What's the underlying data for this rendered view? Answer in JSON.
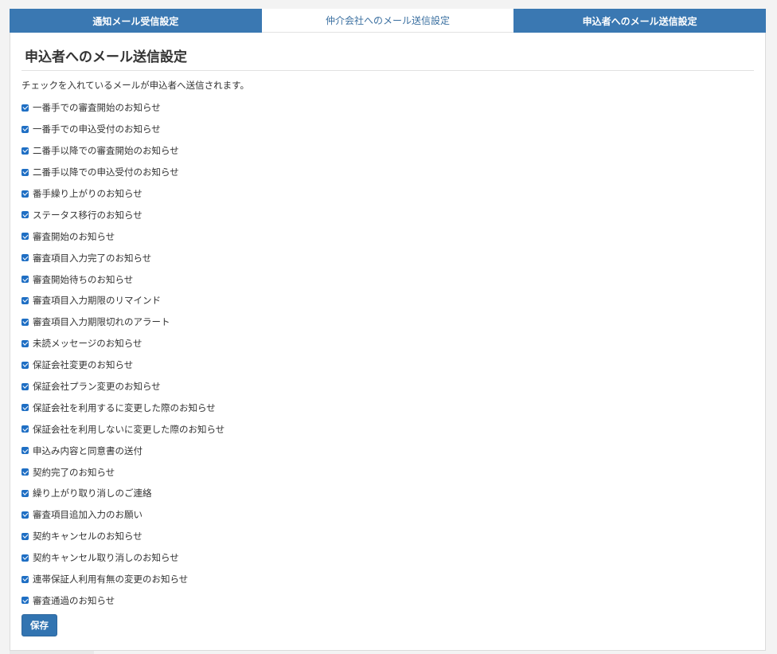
{
  "tabs": [
    {
      "label": "通知メール受信設定",
      "active": false
    },
    {
      "label": "仲介会社へのメール送信設定",
      "active": true
    },
    {
      "label": "申込者へのメール送信設定",
      "active": false
    }
  ],
  "panel": {
    "title": "申込者へのメール送信設定",
    "description": "チェックを入れているメールが申込者へ送信されます。",
    "items": [
      {
        "label": "一番手での審査開始のお知らせ",
        "checked": true
      },
      {
        "label": "一番手での申込受付のお知らせ",
        "checked": true
      },
      {
        "label": "二番手以降での審査開始のお知らせ",
        "checked": true
      },
      {
        "label": "二番手以降での申込受付のお知らせ",
        "checked": true
      },
      {
        "label": "番手繰り上がりのお知らせ",
        "checked": true
      },
      {
        "label": "ステータス移行のお知らせ",
        "checked": true
      },
      {
        "label": "審査開始のお知らせ",
        "checked": true
      },
      {
        "label": "審査項目入力完了のお知らせ",
        "checked": true
      },
      {
        "label": "審査開始待ちのお知らせ",
        "checked": true
      },
      {
        "label": "審査項目入力期限のリマインド",
        "checked": true
      },
      {
        "label": "審査項目入力期限切れのアラート",
        "checked": true
      },
      {
        "label": "未読メッセージのお知らせ",
        "checked": true
      },
      {
        "label": "保証会社変更のお知らせ",
        "checked": true
      },
      {
        "label": "保証会社プラン変更のお知らせ",
        "checked": true
      },
      {
        "label": "保証会社を利用するに変更した際のお知らせ",
        "checked": true
      },
      {
        "label": "保証会社を利用しないに変更した際のお知らせ",
        "checked": true
      },
      {
        "label": "申込み内容と同意書の送付",
        "checked": true
      },
      {
        "label": "契約完了のお知らせ",
        "checked": true
      },
      {
        "label": "繰り上がり取り消しのご連絡",
        "checked": true
      },
      {
        "label": "審査項目追加入力のお願い",
        "checked": true
      },
      {
        "label": "契約キャンセルのお知らせ",
        "checked": true
      },
      {
        "label": "契約キャンセル取り消しのお知らせ",
        "checked": true
      },
      {
        "label": "連帯保証人利用有無の変更のお知らせ",
        "checked": true
      },
      {
        "label": "審査通過のお知らせ",
        "checked": true
      }
    ],
    "save_label": "保存"
  },
  "colors": {
    "tab_inactive_bg": "#3a78b2",
    "tab_active_text": "#3a6fa0",
    "checkbox": "#1f6fc4",
    "button": "#3274b1"
  }
}
